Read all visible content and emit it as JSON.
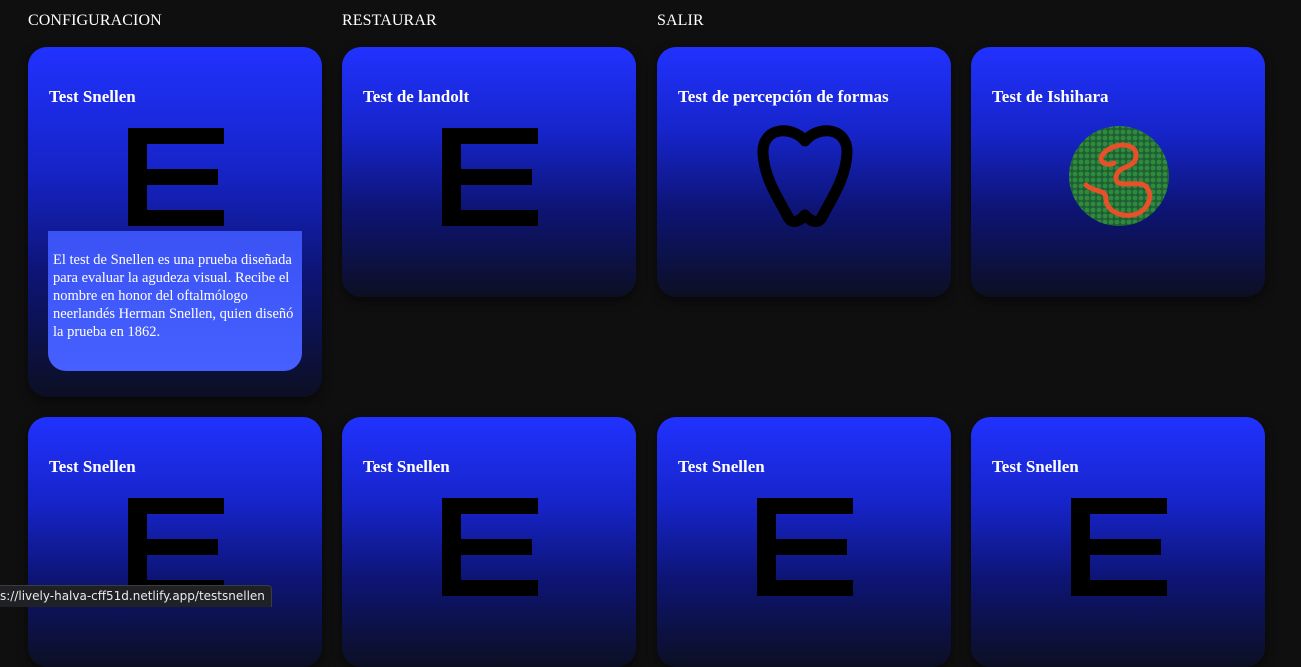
{
  "nav": {
    "items": [
      {
        "label": "CONFIGURACION"
      },
      {
        "label": "RESTAURAR"
      },
      {
        "label": "SALIR"
      }
    ]
  },
  "cards": [
    {
      "title": "Test Snellen",
      "icon": "snellen-e-icon",
      "description": "El test de Snellen es una prueba diseñada para evaluar la agudeza visual. Recibe el nombre en honor del oftalmólogo neerlandés Herman Snellen, quien diseñó la prueba en 1862."
    },
    {
      "title": "Test de landolt",
      "icon": "snellen-e-icon"
    },
    {
      "title": "Test de percepción de formas",
      "icon": "apple-shape-icon"
    },
    {
      "title": "Test de Ishihara",
      "icon": "ishihara-plate-icon"
    },
    {
      "title": "Test Snellen",
      "icon": "snellen-e-icon"
    },
    {
      "title": "Test Snellen",
      "icon": "snellen-e-icon"
    },
    {
      "title": "Test Snellen",
      "icon": "snellen-e-icon"
    },
    {
      "title": "Test Snellen",
      "icon": "snellen-e-icon"
    }
  ],
  "status": {
    "url": "s://lively-halva-cff51d.netlify.app/testsnellen"
  },
  "colors": {
    "background": "#0f0f10",
    "card_top": "#2132ff",
    "card_bottom": "#0c0f22",
    "description_bg": "#4660ff",
    "ishihara_dots": "#2e8b3e",
    "ishihara_path": "#e8502a"
  }
}
